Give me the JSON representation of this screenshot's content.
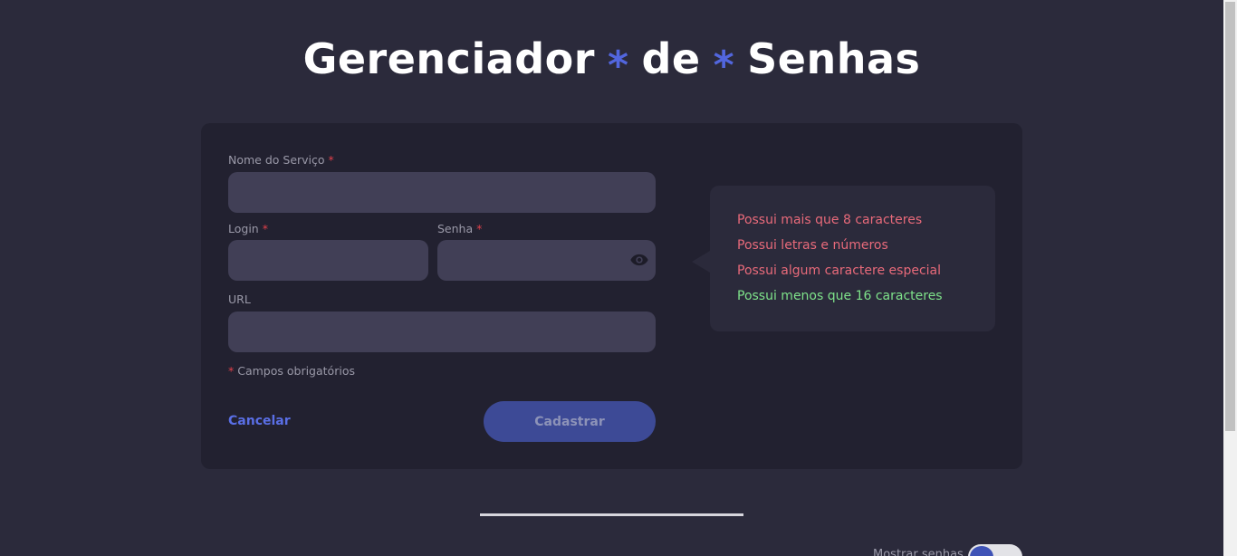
{
  "header": {
    "title_part1": "Gerenciador",
    "star": "*",
    "title_part2": "de",
    "title_part3": "Senhas"
  },
  "form": {
    "service_label": "Nome do Serviço",
    "login_label": "Login",
    "password_label": "Senha",
    "url_label": "URL",
    "required_mark": "*",
    "required_hint": "Campos obrigatórios",
    "service_value": "",
    "login_value": "",
    "password_value": "",
    "url_value": "",
    "cancel_label": "Cancelar",
    "submit_label": "Cadastrar"
  },
  "password_rules": [
    {
      "text": "Possui mais que 8 caracteres",
      "status": "invalid"
    },
    {
      "text": "Possui letras e números",
      "status": "invalid"
    },
    {
      "text": "Possui algum caractere especial",
      "status": "invalid"
    },
    {
      "text": "Possui menos que 16 caracteres",
      "status": "valid"
    }
  ],
  "footer": {
    "toggle_label": "Mostrar senhas",
    "toggle_on": false
  },
  "colors": {
    "accent": "#5266de",
    "invalid": "#e86a7a",
    "valid": "#7ee28a",
    "background": "#2b2a3b",
    "card": "#222130"
  }
}
